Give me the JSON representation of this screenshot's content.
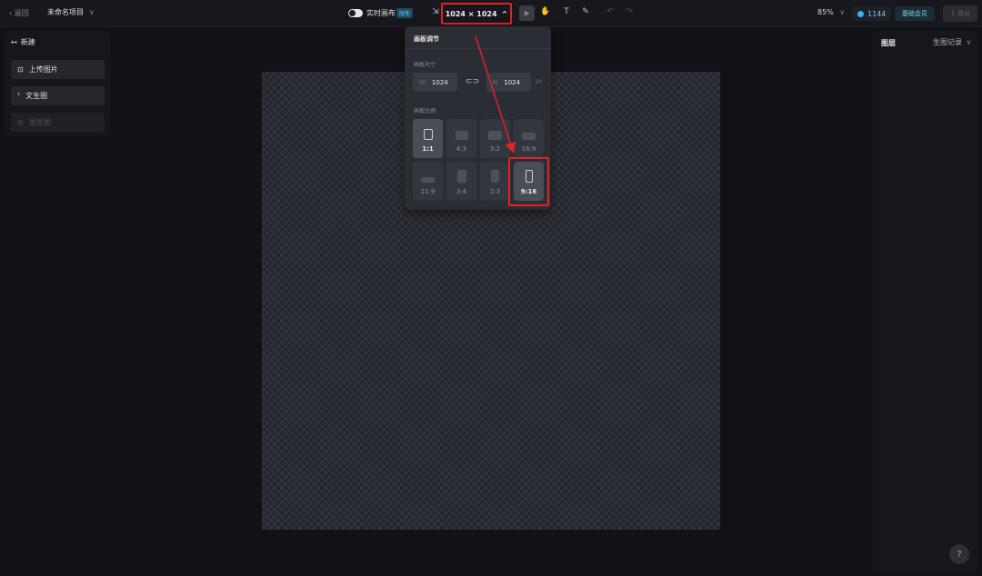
{
  "topbar": {
    "back_label": "‹ 返回",
    "project_name": "未命名项目",
    "project_chevron": "∨",
    "realtime_label": "实时画布",
    "realtime_badge": "限免",
    "canvas_size": "1024 × 1024",
    "canvas_size_chevron": "^",
    "zoom": "85%",
    "zoom_chevron": "∨",
    "credits": "1144",
    "member_label": "基础会员",
    "export_label": "⇩ 导出"
  },
  "left_panel": {
    "new_label": "新建",
    "buttons": [
      {
        "label": "上传图片",
        "icon": "upload-image-icon"
      },
      {
        "label": "文生图",
        "icon": "text-to-image-icon"
      },
      {
        "label": "图生图",
        "icon": "image-to-image-icon"
      }
    ]
  },
  "canvas_popup": {
    "title": "画板调节",
    "size_label": "画板尺寸",
    "width_label": "W",
    "width_value": "1024",
    "height_label": "H",
    "height_value": "1024",
    "unit": "px",
    "ratio_label": "画板比例",
    "ratios": [
      "1:1",
      "4:3",
      "3:2",
      "16:9",
      "21:9",
      "3:4",
      "2:3",
      "9:16"
    ]
  },
  "right_panel": {
    "layers_label": "图层",
    "history_label": "生图记录",
    "history_chevron": "∨",
    "help_label": "?"
  },
  "colors": {
    "highlight": "#e02323",
    "accent": "#37b2ea"
  }
}
